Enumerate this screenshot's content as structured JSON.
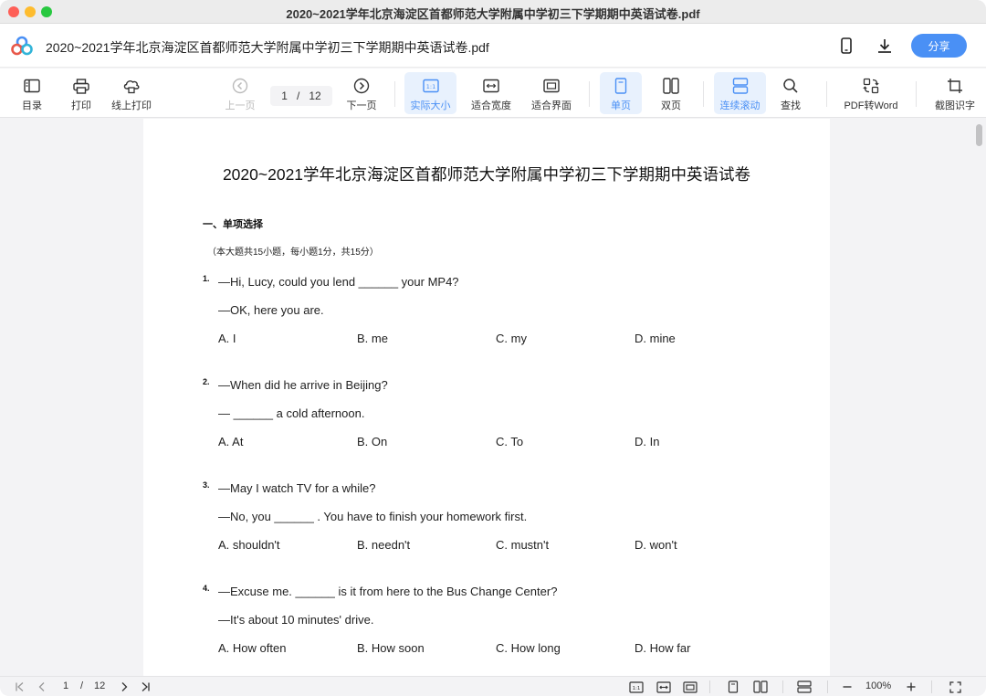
{
  "window": {
    "title": "2020~2021学年北京海淀区首都师范大学附属中学初三下学期期中英语试卷.pdf"
  },
  "header": {
    "doc_title": "2020~2021学年北京海淀区首都师范大学附属中学初三下学期期中英语试卷.pdf",
    "share_label": "分享",
    "icons": [
      "phone-icon",
      "download-icon"
    ]
  },
  "toolbar": {
    "contents": "目录",
    "print": "打印",
    "online_print": "线上打印",
    "prev_page": "上一页",
    "current_page": "1",
    "page_sep": "/",
    "total_pages": "12",
    "next_page": "下一页",
    "actual_size": "实际大小",
    "fit_width": "适合宽度",
    "fit_page": "适合界面",
    "single_page": "单页",
    "double_page": "双页",
    "continuous": "连续滚动",
    "find": "查找",
    "pdf_to_word": "PDF转Word",
    "ocr": "截图识字",
    "accent_color": "#4a90f5"
  },
  "document": {
    "title": "2020~2021学年北京海淀区首都师范大学附属中学初三下学期期中英语试卷",
    "section_heading": "一、单项选择",
    "section_note": "（本大题共15小题，每小题1分，共15分）",
    "questions": [
      {
        "num": "1.",
        "lines": [
          "—Hi, Lucy, could you lend ______ your MP4?",
          "—OK, here you are."
        ],
        "options": [
          "A. I",
          "B. me",
          "C. my",
          "D. mine"
        ]
      },
      {
        "num": "2.",
        "lines": [
          "—When did he arrive in Beijing?",
          "— ______ a cold afternoon."
        ],
        "options": [
          "A. At",
          "B. On",
          "C. To",
          "D. In"
        ]
      },
      {
        "num": "3.",
        "lines": [
          "—May I watch TV for a while?",
          "—No, you ______ . You have to finish your homework first."
        ],
        "options": [
          "A. shouldn't",
          "B. needn't",
          "C. mustn't",
          "D. won't"
        ]
      },
      {
        "num": "4.",
        "lines": [
          "—Excuse me. ______ is it from here to the Bus Change Center?",
          "—It's about 10 minutes' drive."
        ],
        "options": [
          "A. How often",
          "B. How soon",
          "C. How long",
          "D. How far"
        ]
      }
    ]
  },
  "statusbar": {
    "current_page": "1",
    "page_sep": "/",
    "total_pages": "12",
    "zoom": "100%"
  }
}
